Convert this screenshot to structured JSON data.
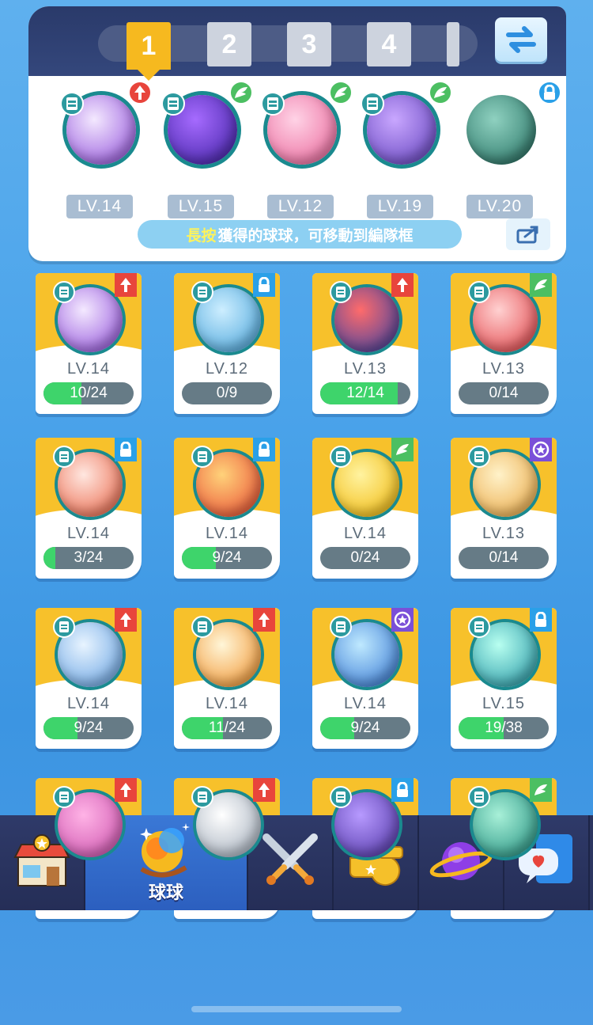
{
  "team": {
    "tabs": [
      {
        "label": "1",
        "active": true
      },
      {
        "label": "2",
        "active": false
      },
      {
        "label": "3",
        "active": false
      },
      {
        "label": "4",
        "active": false
      }
    ],
    "swap_icon": "swap-arrows-icon",
    "slots": [
      {
        "level": "LV.14",
        "badge": "arrow-up-icon",
        "badge_color": "#e8453c",
        "orb": "infinity-star-orb",
        "colors": [
          "#f4e9ff",
          "#8a45d8"
        ]
      },
      {
        "level": "LV.15",
        "badge": "wing-icon",
        "badge_color": "#4cbf62",
        "orb": "lightning-orb",
        "colors": [
          "#a66bff",
          "#3a1d9e"
        ]
      },
      {
        "level": "LV.12",
        "badge": "wing-icon",
        "badge_color": "#4cbf62",
        "orb": "winged-shield-orb",
        "colors": [
          "#ffd3e6",
          "#e85d94"
        ]
      },
      {
        "level": "LV.19",
        "badge": "wing-icon",
        "badge_color": "#4cbf62",
        "orb": "people-orb",
        "colors": [
          "#c9a7ff",
          "#5b3bb8"
        ]
      },
      {
        "level": "LV.20",
        "badge": "lock-icon",
        "badge_color": "#2aa0e8",
        "orb": "chain-orb",
        "colors": [
          "#8fd1c0",
          "#1f6b5d"
        ]
      }
    ],
    "hint_highlight": "長按",
    "hint_rest": "獲得的球球，可移動到編隊框",
    "share_icon": "share-icon"
  },
  "collection": [
    {
      "level": "LV.14",
      "progress": "10/24",
      "fill": 0.42,
      "corner": "arrow-up-icon",
      "corner_color": "#e8453c",
      "orb": "infinity-star-orb",
      "colors": [
        "#f4e9ff",
        "#8a45d8"
      ]
    },
    {
      "level": "LV.12",
      "progress": "0/9",
      "fill": 0.0,
      "corner": "lock-icon",
      "corner_color": "#2aa0e8",
      "orb": "compass-star-orb",
      "colors": [
        "#cdeeff",
        "#3f9fd8"
      ]
    },
    {
      "level": "LV.13",
      "progress": "12/14",
      "fill": 0.86,
      "corner": "arrow-up-icon",
      "corner_color": "#e8453c",
      "orb": "opera-mask-orb",
      "colors": [
        "#ff6b6b",
        "#2b3ea8"
      ]
    },
    {
      "level": "LV.13",
      "progress": "0/14",
      "fill": 0.0,
      "corner": "wing-icon",
      "corner_color": "#4cbf62",
      "orb": "red-envelope-orb",
      "colors": [
        "#ffd1d1",
        "#e0393e"
      ]
    },
    {
      "level": "LV.14",
      "progress": "3/24",
      "fill": 0.13,
      "corner": "lock-icon",
      "corner_color": "#2aa0e8",
      "orb": "aries-orb",
      "colors": [
        "#ffe7e0",
        "#e85a3a"
      ]
    },
    {
      "level": "LV.14",
      "progress": "9/24",
      "fill": 0.38,
      "corner": "lock-icon",
      "corner_color": "#2aa0e8",
      "orb": "sun-star-orb",
      "colors": [
        "#ffd27a",
        "#e8432e"
      ]
    },
    {
      "level": "LV.14",
      "progress": "0/24",
      "fill": 0.0,
      "corner": "wing-icon",
      "corner_color": "#4cbf62",
      "orb": "sun-orb",
      "colors": [
        "#fff3a0",
        "#f0b400"
      ]
    },
    {
      "level": "LV.13",
      "progress": "0/14",
      "fill": 0.0,
      "corner": "star-circle-icon",
      "corner_color": "#7a4fd8",
      "orb": "cup-orb",
      "colors": [
        "#fff2c9",
        "#e8a23a"
      ]
    },
    {
      "level": "LV.14",
      "progress": "9/24",
      "fill": 0.38,
      "corner": "arrow-up-icon",
      "corner_color": "#e8453c",
      "orb": "plane-orb",
      "colors": [
        "#e8f4ff",
        "#5b9be0"
      ]
    },
    {
      "level": "LV.14",
      "progress": "11/24",
      "fill": 0.46,
      "corner": "arrow-up-icon",
      "corner_color": "#e8453c",
      "orb": "vortex-orb",
      "colors": [
        "#fff6d8",
        "#f08a1e"
      ]
    },
    {
      "level": "LV.14",
      "progress": "9/24",
      "fill": 0.38,
      "corner": "star-circle-icon",
      "corner_color": "#7a4fd8",
      "orb": "potion-orb",
      "colors": [
        "#bfe9ff",
        "#2b6fd0"
      ]
    },
    {
      "level": "LV.15",
      "progress": "19/38",
      "fill": 0.5,
      "corner": "lock-icon",
      "corner_color": "#2aa0e8",
      "orb": "wind-orb",
      "colors": [
        "#b8fff0",
        "#1a8fa0"
      ]
    },
    {
      "level": "",
      "progress": "",
      "fill": 0.0,
      "corner": "arrow-up-icon",
      "corner_color": "#e8453c",
      "orb": "partial-orb",
      "colors": [
        "#ffb3e6",
        "#c84aa8"
      ]
    },
    {
      "level": "",
      "progress": "",
      "fill": 0.0,
      "corner": "arrow-up-icon",
      "corner_color": "#e8453c",
      "orb": "partial-orb",
      "colors": [
        "#ffffff",
        "#9aa6b5"
      ]
    },
    {
      "level": "",
      "progress": "",
      "fill": 0.0,
      "corner": "lock-icon",
      "corner_color": "#2aa0e8",
      "orb": "partial-orb",
      "colors": [
        "#b79aff",
        "#4a2fa0"
      ]
    },
    {
      "level": "",
      "progress": "",
      "fill": 0.0,
      "corner": "wing-icon",
      "corner_color": "#4cbf62",
      "orb": "partial-orb",
      "colors": [
        "#a8f0d8",
        "#1a8a7a"
      ]
    }
  ],
  "nav": [
    {
      "icon": "shop-icon",
      "label": "",
      "active": false
    },
    {
      "icon": "balls-icon",
      "label": "球球",
      "active": true
    },
    {
      "icon": "crossed-swords-icon",
      "label": "",
      "active": false
    },
    {
      "icon": "whistle-icon",
      "label": "",
      "active": false
    },
    {
      "icon": "planet-icon",
      "label": "",
      "active": false
    },
    {
      "icon": "chat-heart-icon",
      "label": "",
      "active": false
    }
  ]
}
